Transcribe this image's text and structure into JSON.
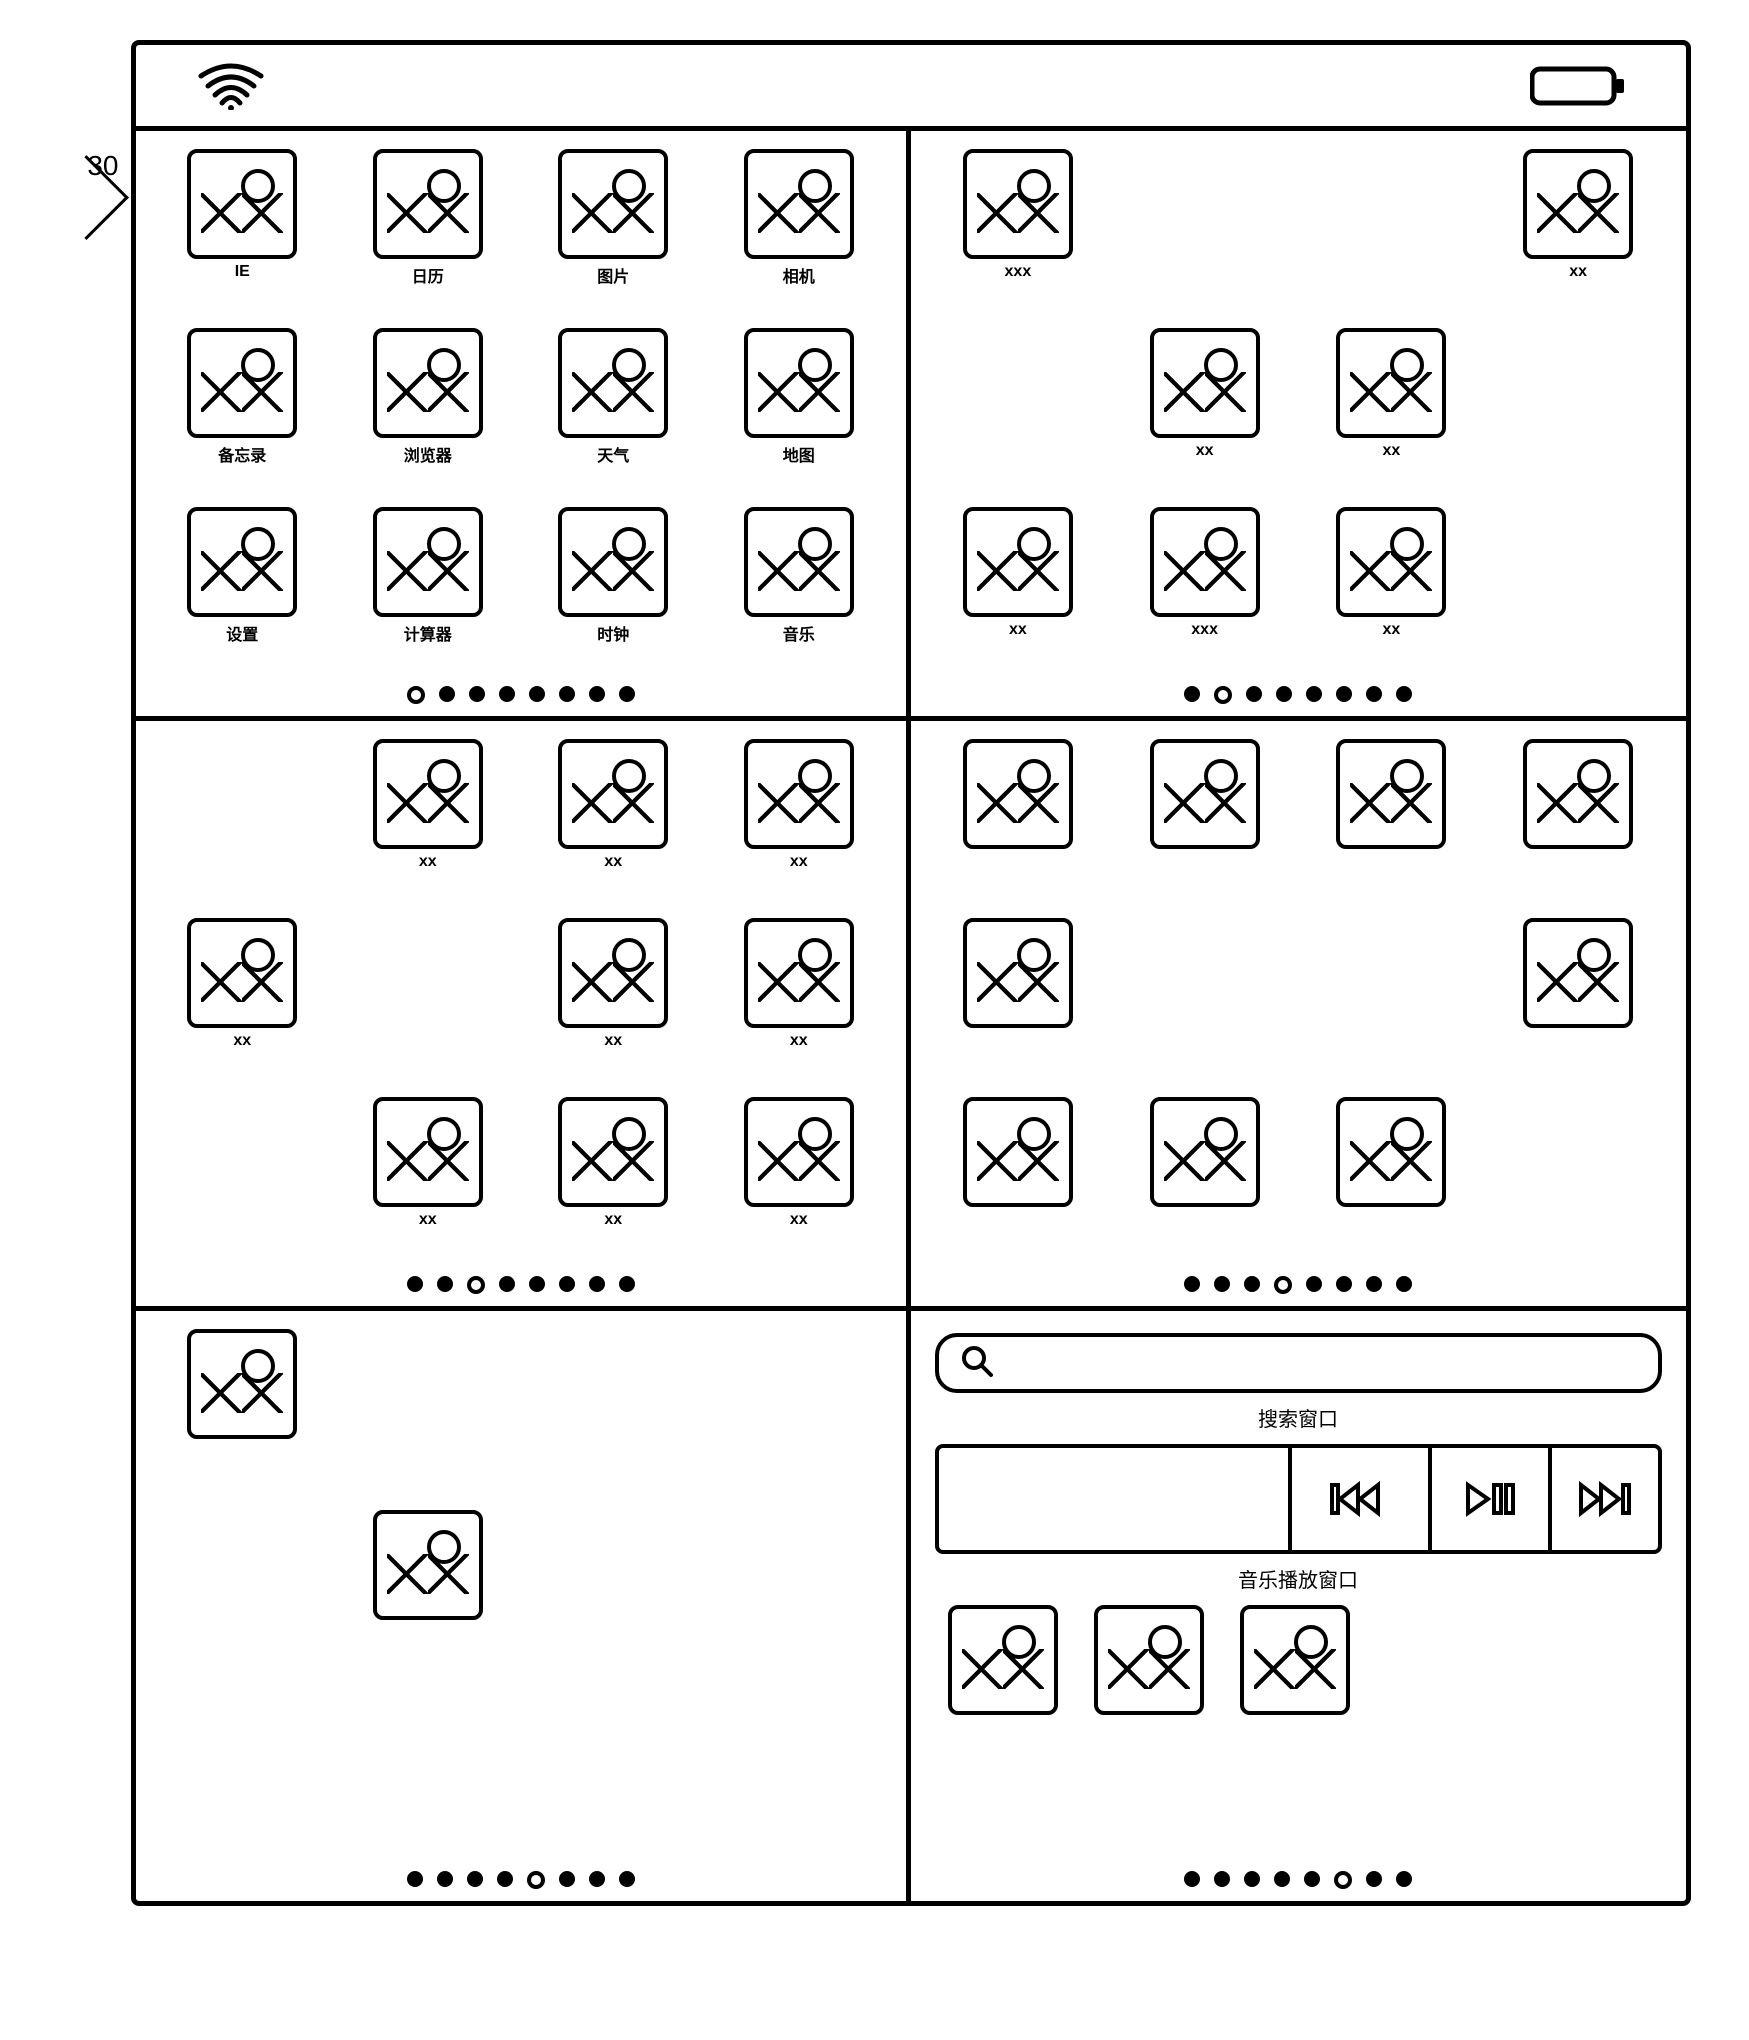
{
  "callout_ref": "30",
  "statusbar": {
    "wifi_icon": "wifi",
    "battery_icon": "battery"
  },
  "panels": [
    {
      "id": "panel-1",
      "page_count": 8,
      "active_page": 0,
      "grid": [
        {
          "label": "IE"
        },
        {
          "label": "日历"
        },
        {
          "label": "图片"
        },
        {
          "label": "相机"
        },
        {
          "label": "备忘录"
        },
        {
          "label": "浏览器"
        },
        {
          "label": "天气"
        },
        {
          "label": "地图"
        },
        {
          "label": "设置"
        },
        {
          "label": "计算器"
        },
        {
          "label": "时钟"
        },
        {
          "label": "音乐"
        }
      ]
    },
    {
      "id": "panel-2",
      "page_count": 8,
      "active_page": 1,
      "grid": [
        {
          "label": "xxx"
        },
        null,
        null,
        {
          "label": "xx"
        },
        null,
        {
          "label": "xx"
        },
        {
          "label": "xx"
        },
        null,
        {
          "label": "xx"
        },
        {
          "label": "xxx"
        },
        {
          "label": "xx"
        },
        null
      ]
    },
    {
      "id": "panel-3",
      "page_count": 8,
      "active_page": 2,
      "grid": [
        null,
        {
          "label": "xx"
        },
        {
          "label": "xx"
        },
        {
          "label": "xx"
        },
        {
          "label": "xx"
        },
        null,
        {
          "label": "xx"
        },
        {
          "label": "xx"
        },
        null,
        {
          "label": "xx"
        },
        {
          "label": "xx"
        },
        {
          "label": "xx"
        }
      ]
    },
    {
      "id": "panel-4",
      "page_count": 8,
      "active_page": 3,
      "grid": [
        {
          "label": ""
        },
        {
          "label": ""
        },
        {
          "label": ""
        },
        {
          "label": ""
        },
        {
          "label": ""
        },
        null,
        null,
        {
          "label": ""
        },
        {
          "label": ""
        },
        {
          "label": ""
        },
        {
          "label": ""
        },
        null
      ]
    },
    {
      "id": "panel-5",
      "page_count": 8,
      "active_page": 4,
      "grid": [
        {
          "label": ""
        },
        null,
        null,
        null,
        null,
        {
          "label": ""
        },
        null,
        null,
        null,
        null,
        null,
        null
      ]
    },
    {
      "id": "panel-6",
      "page_count": 8,
      "active_page": 5,
      "search_label": "搜索窗口",
      "music_label": "音乐播放窗口",
      "bottom_apps": [
        {
          "label": ""
        },
        {
          "label": ""
        },
        {
          "label": ""
        }
      ]
    }
  ]
}
